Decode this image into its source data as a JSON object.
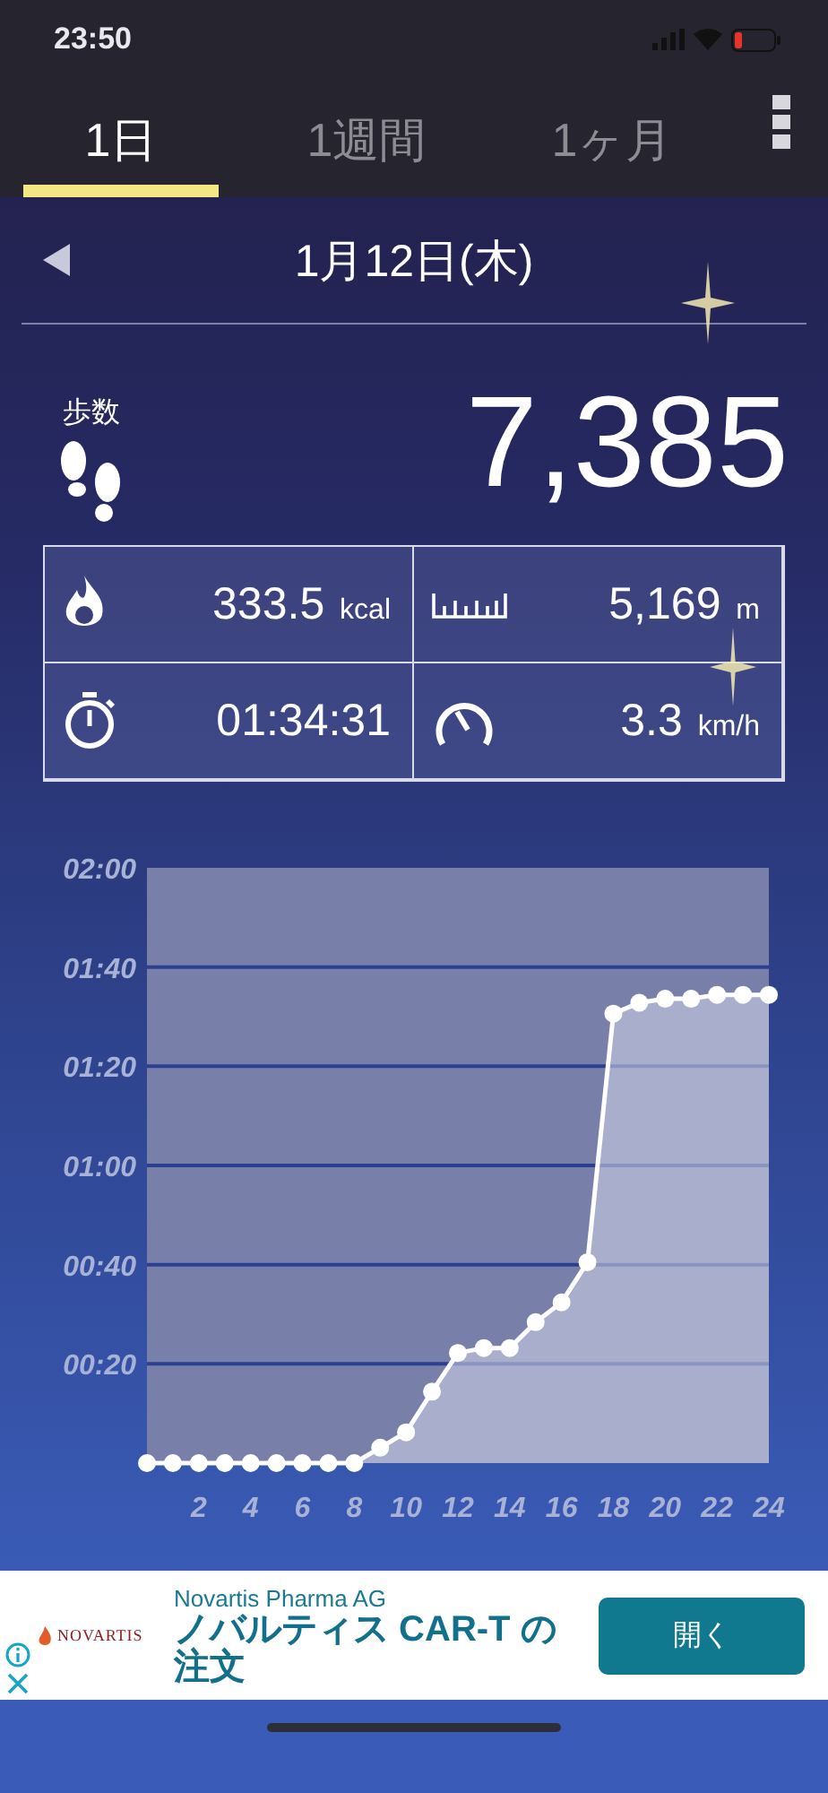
{
  "status_bar": {
    "time": "23:50"
  },
  "tabs": [
    {
      "label": "1日",
      "selected": true
    },
    {
      "label": "1週間",
      "selected": false
    },
    {
      "label": "1ヶ月",
      "selected": false
    }
  ],
  "date_nav": {
    "date": "1月12日(木)"
  },
  "steps": {
    "label": "歩数",
    "value": "7,385"
  },
  "stats": [
    {
      "kind": "calories",
      "value": "333.5",
      "unit": "kcal"
    },
    {
      "kind": "distance",
      "value": "5,169",
      "unit": "m"
    },
    {
      "kind": "duration",
      "value": "01:34:31"
    },
    {
      "kind": "speed",
      "value": "3.3",
      "unit": "km/h"
    }
  ],
  "chart": {
    "chart_data": {
      "type": "area",
      "x": [
        0,
        1,
        2,
        3,
        4,
        5,
        6,
        7,
        8,
        9,
        10,
        11,
        12,
        13,
        14,
        15,
        16,
        17,
        18,
        19,
        20,
        21,
        22,
        23,
        24
      ],
      "values": [
        0,
        0,
        0,
        0,
        0,
        0,
        0,
        0,
        0,
        3.1,
        6.2,
        14.4,
        22.2,
        23.2,
        23.2,
        28.4,
        32.4,
        40.5,
        90.6,
        92.8,
        93.6,
        93.6,
        94.4,
        94.4,
        94.4
      ],
      "grid": true,
      "xlim": [
        0,
        24
      ],
      "ylim": [
        0,
        120
      ],
      "xticks": [
        2,
        4,
        6,
        8,
        10,
        12,
        14,
        16,
        18,
        20,
        22,
        24
      ],
      "yticks": [
        {
          "value": 20,
          "label": "00:20"
        },
        {
          "value": 40,
          "label": "00:40"
        },
        {
          "value": 60,
          "label": "01:00"
        },
        {
          "value": 80,
          "label": "01:20"
        },
        {
          "value": 100,
          "label": "01:40"
        },
        {
          "value": 120,
          "label": "02:00"
        }
      ]
    }
  },
  "ad": {
    "advertiser": "Novartis Pharma AG",
    "brand": "NOVARTIS",
    "headline": "ノバルティス CAR-T の注文",
    "button": "開く"
  }
}
